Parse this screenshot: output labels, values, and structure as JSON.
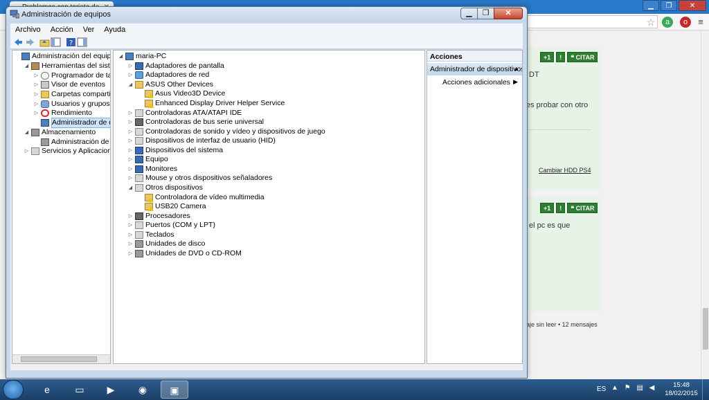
{
  "browser": {
    "tab_title": "Problemas con tarjeta de",
    "tab_close": "✕",
    "window_buttons": [
      "▁",
      "❐",
      "✕"
    ],
    "posts": [
      {
        "buttons": [
          "+1",
          "!",
          "❝ CITAR"
        ],
        "lines": [
          "DT",
          "es probar con otro"
        ],
        "link": "Cambiar HDD PS4"
      },
      {
        "buttons": [
          "+1",
          "!",
          "❝ CITAR"
        ],
        "lines": [
          "el pc es que"
        ]
      }
    ],
    "footer_text": "aje sin leer • 12 mensajes"
  },
  "mmc": {
    "title": "Administración de equipos",
    "window_buttons": [
      "▁",
      "❐",
      "✕"
    ],
    "menu": [
      "Archivo",
      "Acción",
      "Ver",
      "Ayuda"
    ],
    "left_tree": [
      {
        "label": "Administración del equipo (local)",
        "level": 0,
        "icon": "pc",
        "expander": ""
      },
      {
        "label": "Herramientas del sistema",
        "level": 1,
        "icon": "tools",
        "expander": "◢"
      },
      {
        "label": "Programador de tareas",
        "level": 2,
        "icon": "clock",
        "expander": "▷"
      },
      {
        "label": "Visor de eventos",
        "level": 2,
        "icon": "event",
        "expander": "▷"
      },
      {
        "label": "Carpetas compartidas",
        "level": 2,
        "icon": "folder",
        "expander": "▷"
      },
      {
        "label": "Usuarios y grupos locales",
        "level": 2,
        "icon": "users",
        "expander": "▷"
      },
      {
        "label": "Rendimiento",
        "level": 2,
        "icon": "perf",
        "expander": "▷"
      },
      {
        "label": "Administrador de dispositivos",
        "level": 2,
        "icon": "pc",
        "expander": "",
        "selected": true
      },
      {
        "label": "Almacenamiento",
        "level": 1,
        "icon": "disk",
        "expander": "◢"
      },
      {
        "label": "Administración de discos",
        "level": 2,
        "icon": "disk",
        "expander": ""
      },
      {
        "label": "Servicios y Aplicaciones",
        "level": 1,
        "icon": "dev",
        "expander": "▷"
      }
    ],
    "device_tree": [
      {
        "label": "maria-PC",
        "level": 0,
        "icon": "pc",
        "expander": "◢"
      },
      {
        "label": "Adaptadores de pantalla",
        "level": 1,
        "icon": "monitor",
        "expander": "▷"
      },
      {
        "label": "Adaptadores de red",
        "level": 1,
        "icon": "net",
        "expander": "▷"
      },
      {
        "label": "ASUS Other Devices",
        "level": 1,
        "icon": "warnfold",
        "expander": "◢"
      },
      {
        "label": "Asus Video3D Device",
        "level": 2,
        "icon": "warnfold warn",
        "expander": ""
      },
      {
        "label": "Enhanced Display Driver Helper Service",
        "level": 2,
        "icon": "warnfold warn",
        "expander": ""
      },
      {
        "label": "Controladoras ATA/ATAPI IDE",
        "level": 1,
        "icon": "dev",
        "expander": "▷"
      },
      {
        "label": "Controladoras de bus serie universal",
        "level": 1,
        "icon": "chip",
        "expander": "▷"
      },
      {
        "label": "Controladoras de sonido y vídeo y dispositivos de juego",
        "level": 1,
        "icon": "dev",
        "expander": "▷"
      },
      {
        "label": "Dispositivos de interfaz de usuario (HID)",
        "level": 1,
        "icon": "dev",
        "expander": "▷"
      },
      {
        "label": "Dispositivos del sistema",
        "level": 1,
        "icon": "monitor",
        "expander": "▷"
      },
      {
        "label": "Equipo",
        "level": 1,
        "icon": "monitor",
        "expander": "▷"
      },
      {
        "label": "Monitores",
        "level": 1,
        "icon": "monitor",
        "expander": "▷"
      },
      {
        "label": "Mouse y otros dispositivos señaladores",
        "level": 1,
        "icon": "dev",
        "expander": "▷"
      },
      {
        "label": "Otros dispositivos",
        "level": 1,
        "icon": "dev",
        "expander": "◢"
      },
      {
        "label": "Controladora de vídeo multimedia",
        "level": 2,
        "icon": "warnfold warn",
        "expander": ""
      },
      {
        "label": "USB20 Camera",
        "level": 2,
        "icon": "warnfold warn",
        "expander": ""
      },
      {
        "label": "Procesadores",
        "level": 1,
        "icon": "chip",
        "expander": "▷"
      },
      {
        "label": "Puertos (COM y LPT)",
        "level": 1,
        "icon": "dev",
        "expander": "▷"
      },
      {
        "label": "Teclados",
        "level": 1,
        "icon": "dev",
        "expander": "▷"
      },
      {
        "label": "Unidades de disco",
        "level": 1,
        "icon": "disk",
        "expander": "▷"
      },
      {
        "label": "Unidades de DVD o CD-ROM",
        "level": 1,
        "icon": "disk",
        "expander": "▷"
      }
    ],
    "actions": {
      "header": "Acciones",
      "selected": "Administrador de dispositivos",
      "selected_arrow": "▲",
      "more": "Acciones adicionales",
      "more_arrow": "▶"
    }
  },
  "taskbar": {
    "apps": [
      {
        "name": "internet-explorer",
        "glyph": "e"
      },
      {
        "name": "file-explorer",
        "glyph": "▭"
      },
      {
        "name": "media-player",
        "glyph": "▶"
      },
      {
        "name": "chrome",
        "glyph": "◉"
      },
      {
        "name": "computer-management",
        "glyph": "▣",
        "active": true
      }
    ],
    "language": "ES",
    "time": "15:48",
    "date": "18/02/2015"
  }
}
